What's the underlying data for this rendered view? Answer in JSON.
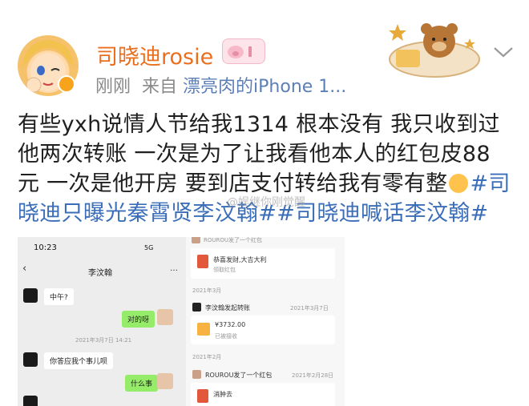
{
  "header": {
    "username": "司晓迪rosie",
    "time": "刚刚",
    "from_label": "来自",
    "source": "漂亮肉的iPhone 1..."
  },
  "post": {
    "line1": "有些yxh说情人节给我1314 根本没有 我只收到过",
    "line2": "他两次转账 一次是为了让我看他本人的红包皮88",
    "line3_text": "元 一次是他开房 要到店支付转给我有零有整",
    "line3_tag": "#司",
    "line4_tags": "晓迪只曝光秦霄贤李汶翰##司晓迪喊话李汶翰#"
  },
  "watermark": "@娱继你刚觉醒",
  "screenshot_left": {
    "time": "10:23",
    "signal": "5G",
    "back": "‹",
    "chat_name": "李汶翰",
    "more": "…",
    "msg1": "中午?",
    "msg2": "对的呀",
    "timestamp": "2021年3月7日 14:21",
    "msg3": "你答应我个事儿呗",
    "msg4": "什么事"
  },
  "screenshot_right": {
    "top_cut": "ROUROU发了一个红包",
    "card1_title": "恭喜发财,大吉大利",
    "card1_sub": "领取红包",
    "month1": "2021年3月",
    "row1_name": "李汶翰发起转账",
    "row1_date": "2021年3月7日",
    "amount": "¥3732.00",
    "received": "已被接收",
    "month2": "2021年2月",
    "row2_name": "ROUROU发了一个红包",
    "row2_date": "2021年2月28日",
    "card3_title": "消肿去"
  },
  "colors": {
    "username": "#eb6e1c",
    "hashtag": "#3b6eb8",
    "meta": "#8a8a8a",
    "verified": "#f7a31b"
  }
}
